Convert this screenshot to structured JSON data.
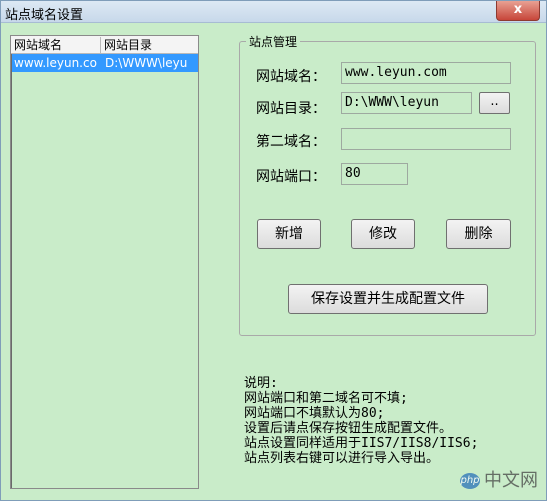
{
  "window": {
    "title": "站点域名设置",
    "close_label": "x"
  },
  "list": {
    "columns": [
      "网站域名",
      "网站目录"
    ],
    "rows": [
      {
        "domain": "www.leyun.co",
        "dir": "D:\\WWW\\leyu"
      }
    ]
  },
  "form": {
    "group_title": "站点管理",
    "domain_label": "网站域名：",
    "domain_value": "www.leyun.com",
    "dir_label": "网站目录：",
    "dir_value": "D:\\WWW\\leyun",
    "browse_label": "..",
    "second_domain_label": "第二域名：",
    "second_domain_value": "",
    "port_label": "网站端口：",
    "port_value": "80",
    "add_label": "新增",
    "edit_label": "修改",
    "delete_label": "删除",
    "save_label": "保存设置并生成配置文件"
  },
  "notes": {
    "lines": [
      "说明:",
      "网站端口和第二域名可不填;",
      "网站端口不填默认为80;",
      "设置后请点保存按钮生成配置文件。",
      "站点设置同样适用于IIS7/IIS8/IIS6;",
      "站点列表右键可以进行导入导出。"
    ]
  },
  "watermark": {
    "badge": "php",
    "text": "中文网"
  }
}
